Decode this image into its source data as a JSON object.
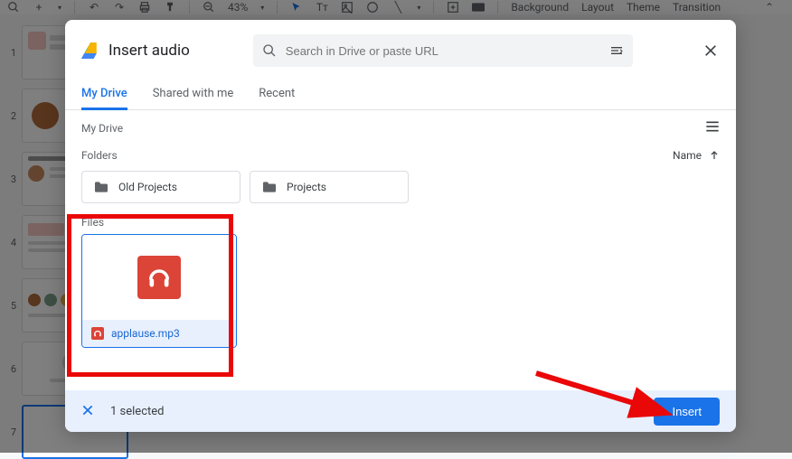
{
  "toolbar": {
    "zoom": "43%",
    "items": [
      "Background",
      "Layout",
      "Theme",
      "Transition"
    ]
  },
  "slides": [
    1,
    2,
    3,
    4,
    5,
    6,
    7
  ],
  "dialog": {
    "title": "Insert audio",
    "search_placeholder": "Search in Drive or paste URL",
    "tabs": [
      "My Drive",
      "Shared with me",
      "Recent"
    ],
    "active_tab": 0,
    "location": "My Drive",
    "folders_label": "Folders",
    "sort_label": "Name",
    "folders": [
      "Old Projects",
      "Projects"
    ],
    "files_label": "Files",
    "file": {
      "name": "applause.mp3"
    },
    "selected_text": "1 selected",
    "insert_label": "Insert"
  }
}
